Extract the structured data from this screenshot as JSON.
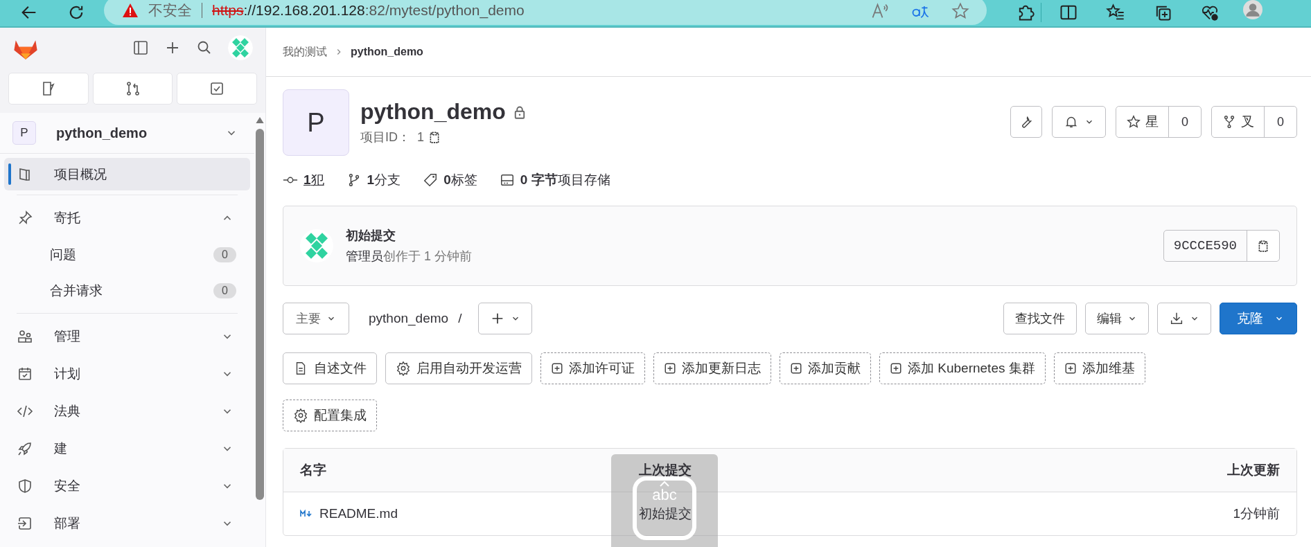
{
  "browser": {
    "security": "不安全",
    "url_scheme": "https",
    "url_host": "://192.168.201.128",
    "url_path": ":82/mytest/python_demo"
  },
  "sidebar": {
    "project": {
      "avatar": "P",
      "name": "python_demo"
    },
    "items": [
      {
        "label": "项目概况",
        "selected": true
      },
      {
        "label": "寄托",
        "selected": false,
        "expanded": true,
        "children": [
          {
            "label": "问题",
            "count": "0"
          },
          {
            "label": "合并请求",
            "count": "0"
          }
        ]
      },
      {
        "label": "管理",
        "selected": false,
        "expanded": false
      },
      {
        "label": "计划",
        "selected": false,
        "expanded": false
      },
      {
        "label": "法典",
        "selected": false,
        "expanded": false
      },
      {
        "label": "建",
        "selected": false,
        "expanded": false
      },
      {
        "label": "安全",
        "selected": false,
        "expanded": false
      },
      {
        "label": "部署",
        "selected": false,
        "expanded": false
      }
    ]
  },
  "breadcrumb": [
    "我的测试",
    "python_demo"
  ],
  "project": {
    "avatar": "P",
    "title": "python_demo",
    "id_label": "项目ID：",
    "id": "1",
    "star": {
      "label": "星",
      "count": "0"
    },
    "fork": {
      "label": "叉",
      "count": "0"
    }
  },
  "stats": [
    "**1**犯",
    "**1**分支",
    "**0**标签",
    "**0 字节**项目存储"
  ],
  "commit": {
    "title": "初始提交",
    "author": "管理员",
    "meta": "创作于 1 分钟前",
    "sha": "9CCCE590"
  },
  "repo": {
    "branch": "主要",
    "path": "python_demo",
    "separator": "/",
    "find": "查找文件",
    "edit": "编辑",
    "clone": "克隆"
  },
  "shortcuts": [
    {
      "label": "自述文件",
      "kind": "file"
    },
    {
      "label": "启用自动开发运营",
      "kind": "setting"
    },
    {
      "label": "添加许可证",
      "kind": "add"
    },
    {
      "label": "添加更新日志",
      "kind": "add"
    },
    {
      "label": "添加贡献",
      "kind": "add"
    },
    {
      "label": "添加 Kubernetes 集群",
      "kind": "add"
    },
    {
      "label": "添加维基",
      "kind": "add"
    },
    {
      "label": "配置集成",
      "kind": "integration"
    }
  ],
  "table": {
    "columns": [
      "名字",
      "上次提交",
      "上次更新"
    ],
    "rows": [
      {
        "name": "README.md",
        "commit": "初始提交",
        "updated": "1分钟前"
      }
    ]
  },
  "ime": {
    "label": "abc"
  }
}
